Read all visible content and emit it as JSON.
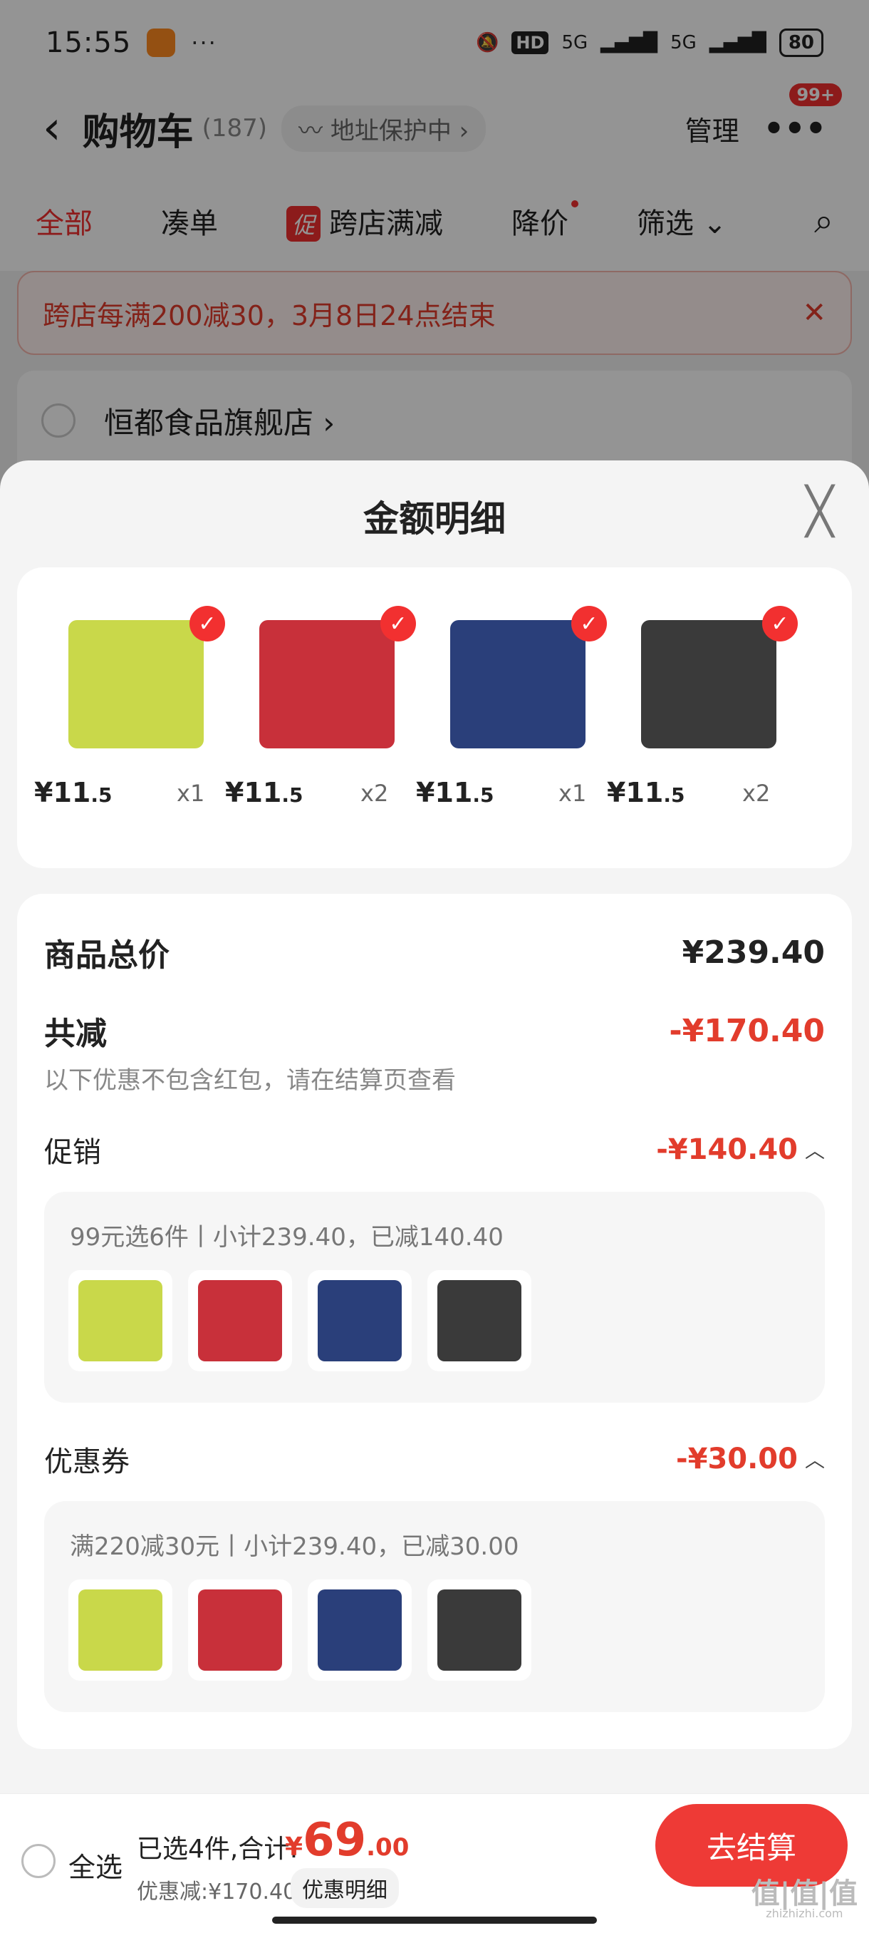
{
  "status_bar": {
    "time": "15:55",
    "more": "···",
    "hd": "HD",
    "net1": "5G",
    "net2": "5G",
    "battery": "80"
  },
  "header": {
    "back": "‹",
    "title": "购物车",
    "count": "(187)",
    "address_protect": "〰 地址保护中 ›",
    "manage": "管理",
    "more": "•••",
    "badge": "99+"
  },
  "tabs": {
    "all": "全部",
    "pair": "凑单",
    "cu": "促",
    "cross_store": "跨店满减",
    "price_drop": "降价",
    "filter": "筛选 ⌄",
    "search": "⌕"
  },
  "promo_banner": {
    "text": "跨店每满200减30，3月8日24点结束",
    "close": "✕"
  },
  "shop": {
    "name": "恒都食品旗舰店 ›"
  },
  "sheet": {
    "title": "金额明细",
    "close": "╳",
    "products": [
      {
        "price_main": "¥11",
        "price_dec": ".5",
        "qty": "x1",
        "color": "#c9d84a"
      },
      {
        "price_main": "¥11",
        "price_dec": ".5",
        "qty": "x2",
        "color": "#c8303a"
      },
      {
        "price_main": "¥11",
        "price_dec": ".5",
        "qty": "x1",
        "color": "#2a3f7a"
      },
      {
        "price_main": "¥11",
        "price_dec": ".5",
        "qty": "x2",
        "color": "#3a3a3a"
      }
    ],
    "check": "✓",
    "total_label": "商品总价",
    "total_value": "¥239.40",
    "discount_label": "共减",
    "discount_value": "-¥170.40",
    "discount_note": "以下优惠不包含红包，请在结算页查看",
    "promo_label": "促销",
    "promo_value": "-¥140.40",
    "promo_box_text": "99元选6件丨小计239.40，已减140.40",
    "coupon_label": "优惠券",
    "coupon_value": "-¥30.00",
    "coupon_box_text": "满220减30元丨小计239.40，已减30.00",
    "chevron": "︿"
  },
  "bottom_bar": {
    "select_all": "全选",
    "selected": "已选4件,合计:",
    "currency": "¥",
    "amount_int": "69",
    "amount_dec": ".00",
    "discount": "优惠减:¥170.40",
    "detail": "优惠明细",
    "checkout": "去结算"
  },
  "watermark": {
    "main": "值|值|值",
    "sub": "zhizhizhi.com"
  }
}
